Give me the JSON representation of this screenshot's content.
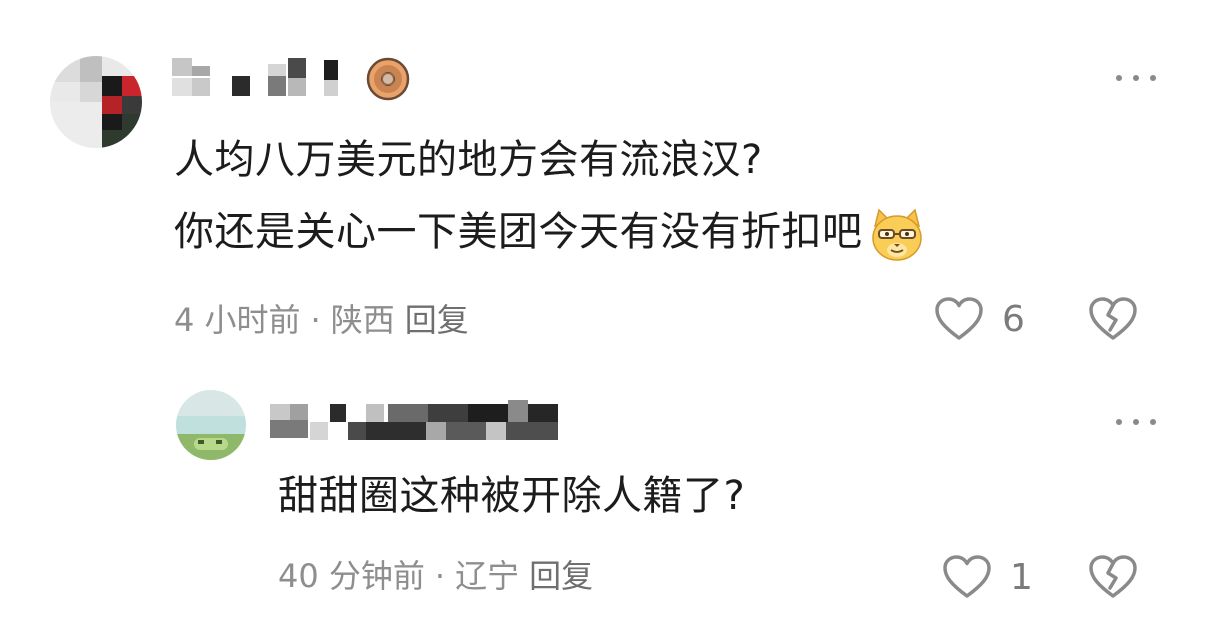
{
  "comments": [
    {
      "text_lines": [
        "人均八万美元的地方会有流浪汉?",
        "你还是关心一下美团今天有没有折扣吧"
      ],
      "time": "4 小时前",
      "location": "陕西",
      "reply_label": "回复",
      "like_count": "6"
    },
    {
      "text_lines": [
        "甜甜圈这种被开除人籍了?"
      ],
      "time": "40 分钟前",
      "location": "辽宁",
      "reply_label": "回复",
      "like_count": "1"
    }
  ],
  "separator": "·",
  "icons": {
    "more": "more-dots-icon",
    "like": "heart-icon",
    "dislike": "broken-heart-icon",
    "badge": "donut-badge-icon",
    "emoji": "cat-glasses-emoji-icon"
  },
  "colors": {
    "text": "#1c1c1c",
    "meta": "#8e8e8e",
    "icon": "#8a8a8a"
  }
}
